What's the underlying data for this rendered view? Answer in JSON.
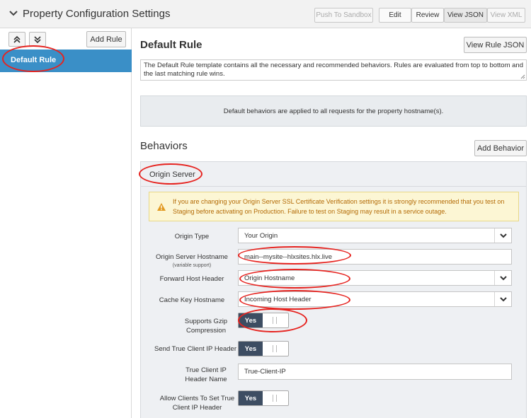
{
  "header": {
    "title": "Property Configuration Settings",
    "buttons": [
      "Push To Sandbox",
      "Edit",
      "Review",
      "View JSON",
      "View XML"
    ]
  },
  "sidebar": {
    "add_rule_label": "Add Rule",
    "rules": [
      "Default Rule"
    ]
  },
  "rule": {
    "title": "Default Rule",
    "view_json_label": "View Rule JSON",
    "description": "The Default Rule template contains all the necessary and recommended behaviors. Rules are evaluated from top to bottom and the last matching rule wins.",
    "note": "Default behaviors are applied to all requests for the property hostname(s)."
  },
  "behaviors": {
    "title": "Behaviors",
    "add_label": "Add Behavior",
    "origin_server": {
      "title": "Origin Server",
      "warning": "If you are changing your Origin Server SSL Certificate Verification settings it is strongly recommended that you test on Staging before activating on Production. Failure to test on Staging may result in a service outage.",
      "fields": {
        "origin_type": {
          "label": "Origin Type",
          "value": "Your Origin"
        },
        "hostname": {
          "label": "Origin Server Hostname",
          "sub": "(variable support)",
          "value": "main--mysite--hlxsites.hlx.live"
        },
        "forward_host": {
          "label": "Forward Host Header",
          "value": "Origin Hostname"
        },
        "cache_key": {
          "label": "Cache Key Hostname",
          "value": "Incoming Host Header"
        },
        "gzip": {
          "label": "Supports Gzip Compression",
          "value": "Yes"
        },
        "send_ip": {
          "label": "Send True Client IP Header",
          "value": "Yes"
        },
        "ip_name": {
          "label": "True Client IP Header Name",
          "value": "True-Client-IP"
        },
        "allow_ip": {
          "label": "Allow Clients To Set True Client IP Header",
          "value": "Yes"
        }
      }
    }
  },
  "colors": {
    "accent": "#3a8fc7",
    "toggle_on": "#3d4d62",
    "annotation": "#e6231f",
    "warning_bg": "#fcf6d4",
    "warning_text": "#b36a05"
  }
}
